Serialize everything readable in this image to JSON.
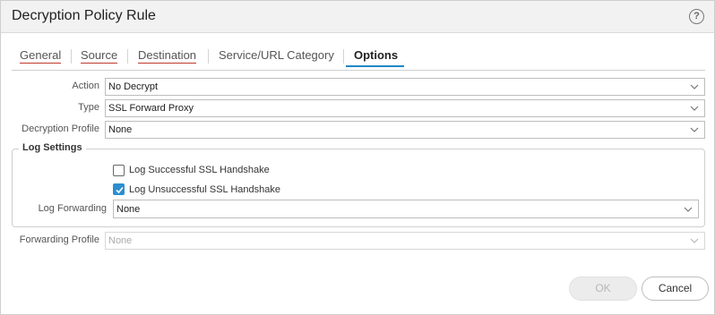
{
  "dialog": {
    "title": "Decryption Policy Rule",
    "help_icon": "?"
  },
  "tabs": [
    {
      "label": "General",
      "error": true
    },
    {
      "label": "Source",
      "error": true
    },
    {
      "label": "Destination",
      "error": true
    },
    {
      "label": "Service/URL Category",
      "error": false
    },
    {
      "label": "Options",
      "active": true
    }
  ],
  "options": {
    "action": {
      "label": "Action",
      "value": "No Decrypt"
    },
    "type": {
      "label": "Type",
      "value": "SSL Forward Proxy"
    },
    "decryption_profile": {
      "label": "Decryption Profile",
      "value": "None"
    }
  },
  "log_settings": {
    "legend": "Log Settings",
    "log_successful": {
      "label": "Log Successful SSL Handshake",
      "checked": false
    },
    "log_unsuccessful": {
      "label": "Log Unsuccessful SSL Handshake",
      "checked": true
    },
    "log_forwarding": {
      "label": "Log Forwarding",
      "value": "None"
    }
  },
  "forwarding_profile": {
    "label": "Forwarding Profile",
    "value": "None",
    "disabled": true
  },
  "buttons": {
    "ok": "OK",
    "cancel": "Cancel"
  },
  "colors": {
    "accent": "#1f88c7",
    "checkbox": "#2b8fd0",
    "error_underline": "#c0392b"
  }
}
